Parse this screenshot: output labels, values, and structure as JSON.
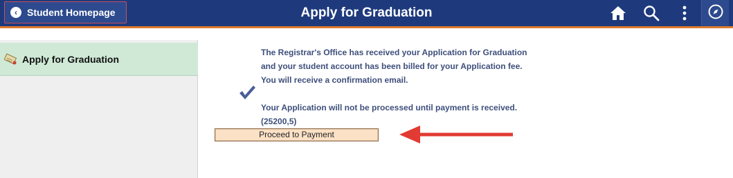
{
  "header": {
    "back_label": "Student Homepage",
    "title": "Apply for Graduation",
    "icons": [
      "home-icon",
      "search-icon",
      "more-vertical-icon",
      "navbar-compass-icon"
    ],
    "bg_color": "#1e3a7d",
    "accent_color": "#e07b2d"
  },
  "sidebar": {
    "items": [
      {
        "label": "Apply for Graduation",
        "icon": "diploma-icon",
        "selected": true
      }
    ]
  },
  "main": {
    "message_paragraph_1": "The Registrar's Office has received your Application for Graduation and your student account has been billed for your Application fee. You will receive a confirmation email.",
    "message_paragraph_2": "Your Application will not be processed until payment is received.",
    "message_code": "(25200,5)",
    "check_icon": "checkmark-icon",
    "proceed_button_label": "Proceed to Payment",
    "annotation": "red-arrow-pointing-left"
  }
}
